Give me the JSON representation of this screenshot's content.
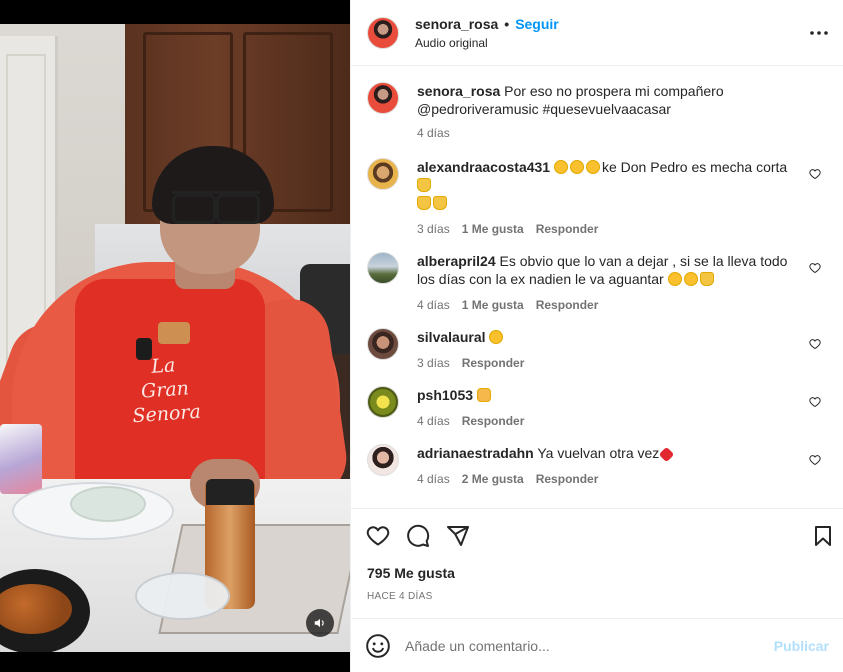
{
  "video": {
    "apron_text_lines": [
      "La",
      "Gran",
      "Senora"
    ],
    "sound_icon": "speaker-icon"
  },
  "header": {
    "username": "senora_rosa",
    "separator": "•",
    "follow_label": "Seguir",
    "audio_label": "Audio original",
    "more_icon": "more-options-icon"
  },
  "caption": {
    "username": "senora_rosa",
    "text": " Por eso no prospera mi compañero @pedroriveramusic #quesevuelvaacasar",
    "time": "4 días"
  },
  "comments": [
    {
      "username": "alexandraacosta431",
      "text": "ke Don Pedro es mecha corta",
      "time": "3 días",
      "likes": "1 Me gusta",
      "reply": "Responder"
    },
    {
      "username": "alberapril24",
      "text": " Es obvio que lo van a dejar , si se la lleva todo los días con la ex nadien le va aguantar",
      "time": "4 días",
      "likes": "1 Me gusta",
      "reply": "Responder"
    },
    {
      "username": "silvalaural",
      "text": "",
      "time": "3 días",
      "likes": "",
      "reply": "Responder"
    },
    {
      "username": "psh1053",
      "text": "",
      "time": "4 días",
      "likes": "",
      "reply": "Responder"
    },
    {
      "username": "adrianaestradahn",
      "text": " Ya vuelvan otra vez",
      "time": "4 días",
      "likes": "2 Me gusta",
      "reply": "Responder"
    }
  ],
  "actions": {
    "like_icon": "heart-icon",
    "comment_icon": "comment-icon",
    "share_icon": "share-icon",
    "save_icon": "bookmark-icon"
  },
  "likes_count": "795 Me gusta",
  "post_time": "HACE 4 DÍAS",
  "add_comment": {
    "placeholder": "Añade un comentario...",
    "publish_label": "Publicar",
    "emoji_icon": "emoji-icon"
  },
  "colors": {
    "accent": "#0095f6",
    "publish_disabled": "#b2dffc",
    "text": "#262626",
    "secondary": "#737373"
  }
}
